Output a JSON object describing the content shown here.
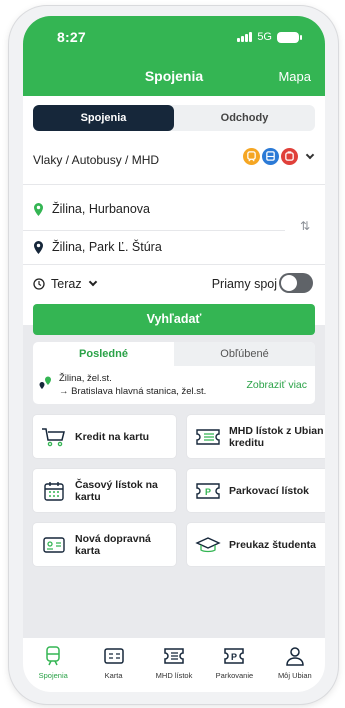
{
  "status": {
    "time": "8:27",
    "network": "5G"
  },
  "header": {
    "title": "Spojenia",
    "map": "Mapa"
  },
  "segment": {
    "connections": "Spojenia",
    "departures": "Odchody"
  },
  "mode": {
    "label": "Vlaky / Autobusy / MHD",
    "icons": [
      "train-icon",
      "bus-icon",
      "tram-icon"
    ],
    "colors": [
      "#f5a623",
      "#2b7ad6",
      "#e0403a"
    ]
  },
  "from": {
    "value": "Žilina,  Hurbanova"
  },
  "to": {
    "value": "Žilina,  Park Ľ. Štúra"
  },
  "time": {
    "label": "Teraz"
  },
  "direct": {
    "label": "Priamy spoj"
  },
  "search_button": "Vyhľadať",
  "recent": {
    "tabs": {
      "recent": "Posledné",
      "favorites": "Obľúbené"
    },
    "item": {
      "from": "Žilina, žel.st.",
      "to": "→ Bratislava hlavná stanica, žel.st."
    },
    "more": "Zobraziť viac"
  },
  "tiles": [
    {
      "label": "Kredit na kartu",
      "icon": "cart-icon"
    },
    {
      "label": "MHD lístok z Ubian kreditu",
      "icon": "ticket-icon"
    },
    {
      "label": "Časový lístok na kartu",
      "icon": "calendar-icon"
    },
    {
      "label": "Parkovací lístok",
      "icon": "parking-icon"
    },
    {
      "label": "Nová dopravná karta",
      "icon": "card-icon"
    },
    {
      "label": "Preukaz študenta",
      "icon": "graduation-cap-icon"
    }
  ],
  "nav": [
    {
      "label": "Spojenia",
      "icon": "connections-icon",
      "active": true
    },
    {
      "label": "Karta",
      "icon": "card-icon"
    },
    {
      "label": "MHD lístok",
      "icon": "ticket-icon"
    },
    {
      "label": "Parkovanie",
      "icon": "parking-icon"
    },
    {
      "label": "Môj Ubian",
      "icon": "user-icon"
    }
  ],
  "colors": {
    "brand": "#34b553",
    "dark": "#16273a"
  }
}
